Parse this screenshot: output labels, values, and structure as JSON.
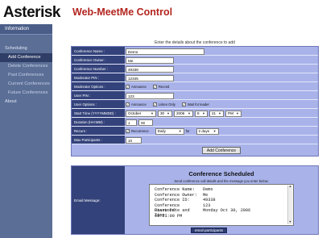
{
  "header": {
    "logo": "Asterisk",
    "title": "Web-MeetMe Control"
  },
  "sidebar": {
    "information": "Information",
    "scheduling": "Scheduling",
    "items": [
      {
        "label": "Add Conference",
        "active": true
      },
      {
        "label": "Delete Conferences",
        "active": false
      },
      {
        "label": "Past Conferences",
        "active": false
      },
      {
        "label": "Current Conferences",
        "active": false
      },
      {
        "label": "Future Conferences",
        "active": false
      }
    ],
    "about": "About"
  },
  "form": {
    "intro": "Enter the details about the conference to add",
    "conference_name_label": "Conference Name :",
    "conference_name": "Demo",
    "conference_owner_label": "Conference Owner :",
    "conference_owner": "Me",
    "conference_number_label": "Conference Number :",
    "conference_number": "49338",
    "moderator_pin_label": "Moderator PIN :",
    "moderator_pin": "12345",
    "moderator_options_label": "Moderator Options :",
    "moderator_announce": "Announce",
    "moderator_record": "Record",
    "user_pin_label": "User PIN :",
    "user_pin": "123",
    "user_options_label": "User Options :",
    "user_announce": "Announce",
    "user_listen_only": "Listen Only",
    "user_wait_leader": "Wait for leader",
    "start_time_label": "Start Time (YYYYMMDD) :",
    "start_month": "October",
    "start_day": "30",
    "start_year": "2006",
    "start_hour": "8",
    "start_minute": "21",
    "start_ampm": "PM",
    "duration_label": "Duration (HH:MM) :",
    "duration_hours": "1",
    "duration_minutes": "00",
    "recurs_label": "Recurs :",
    "recurs_text": "Recurrence",
    "recurs_freq": "Daily",
    "recurs_for": "for",
    "recurs_count": "2 days",
    "max_participants_label": "Max Participants :",
    "max_participants": "10",
    "submit_label": "Add Conference"
  },
  "scheduled": {
    "email_label": "Email Message:",
    "title": "Conference Scheduled",
    "subtitle": "Send conference call details and the message you enter below.",
    "message": [
      {
        "k": "Conference Name:",
        "v": "Demo"
      },
      {
        "k": "Conference Owner:",
        "v": "Me"
      },
      {
        "k": "Conference ID:",
        "v": "49338"
      },
      {
        "k": "Conference Password:",
        "v": "123"
      },
      {
        "k": "Start Date and Time:",
        "v": "Monday Oct 30, 2006"
      },
      {
        "k": "08:21:00 PM",
        "v": ""
      }
    ],
    "email_button": "email participants"
  }
}
